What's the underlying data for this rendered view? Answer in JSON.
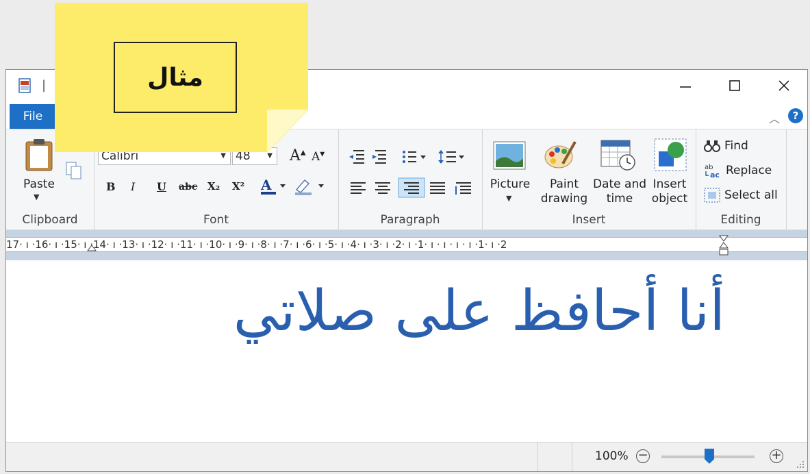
{
  "window": {
    "title_separator": "|"
  },
  "ribbon": {
    "file_tab": "File",
    "groups": {
      "clipboard": {
        "label": "Clipboard",
        "paste": "Paste"
      },
      "font": {
        "label": "Font",
        "font_name": "Calibri",
        "font_size": "48",
        "bold": "B",
        "italic": "I",
        "underline": "U",
        "strike": "abc",
        "sub": "X₂",
        "sup": "X²"
      },
      "paragraph": {
        "label": "Paragraph"
      },
      "insert": {
        "label": "Insert",
        "picture": "Picture",
        "paint_drawing": "Paint drawing",
        "date_time": "Date and time",
        "insert_object": "Insert object"
      },
      "editing": {
        "label": "Editing",
        "find": "Find",
        "replace": "Replace",
        "select_all": "Select all"
      }
    }
  },
  "ruler": {
    "text": "17· ı ·16· ı ·15· ı ·14· ı ·13· ı ·12· ı ·11· ı ·10· ı ·9· ı ·8· ı ·7· ı ·6· ı ·5· ı ·4· ı ·3· ı ·2· ı ·1· ı · ı · ı · ı ·1· ı ·2"
  },
  "document": {
    "text": "أنا أحافظ على صلاتي"
  },
  "sticky_note": {
    "text": "مثال"
  },
  "status": {
    "zoom": "100%",
    "zoom_out": "−",
    "zoom_in": "+"
  },
  "colors": {
    "accent": "#1e6fc6",
    "doc_text": "#2a5fb0",
    "note": "#fcec6a"
  }
}
